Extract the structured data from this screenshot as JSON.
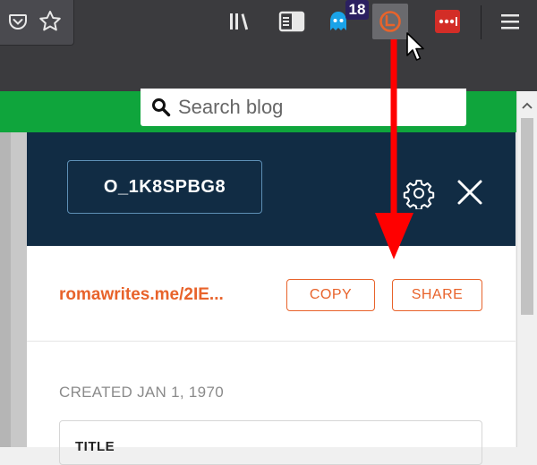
{
  "toolbar": {
    "icons": [
      "pocket-icon",
      "star-icon",
      "library-icon",
      "reader-view-icon",
      "ghostery-icon",
      "rebrandly-icon",
      "lastpass-icon",
      "hamburger-menu-icon"
    ],
    "ghostery_badge": "18"
  },
  "page": {
    "search_placeholder": "Search blog"
  },
  "popup": {
    "shortcode": "O_1K8SPBG8",
    "short_url": "romawrites.me/2IE...",
    "copy_label": "COPY",
    "share_label": "SHARE",
    "created": "CREATED JAN 1, 1970",
    "title_label": "TITLE"
  },
  "colors": {
    "accent": "#e8632b",
    "header": "#112c44",
    "green": "#0fa53c",
    "arrow": "#ff0000"
  }
}
